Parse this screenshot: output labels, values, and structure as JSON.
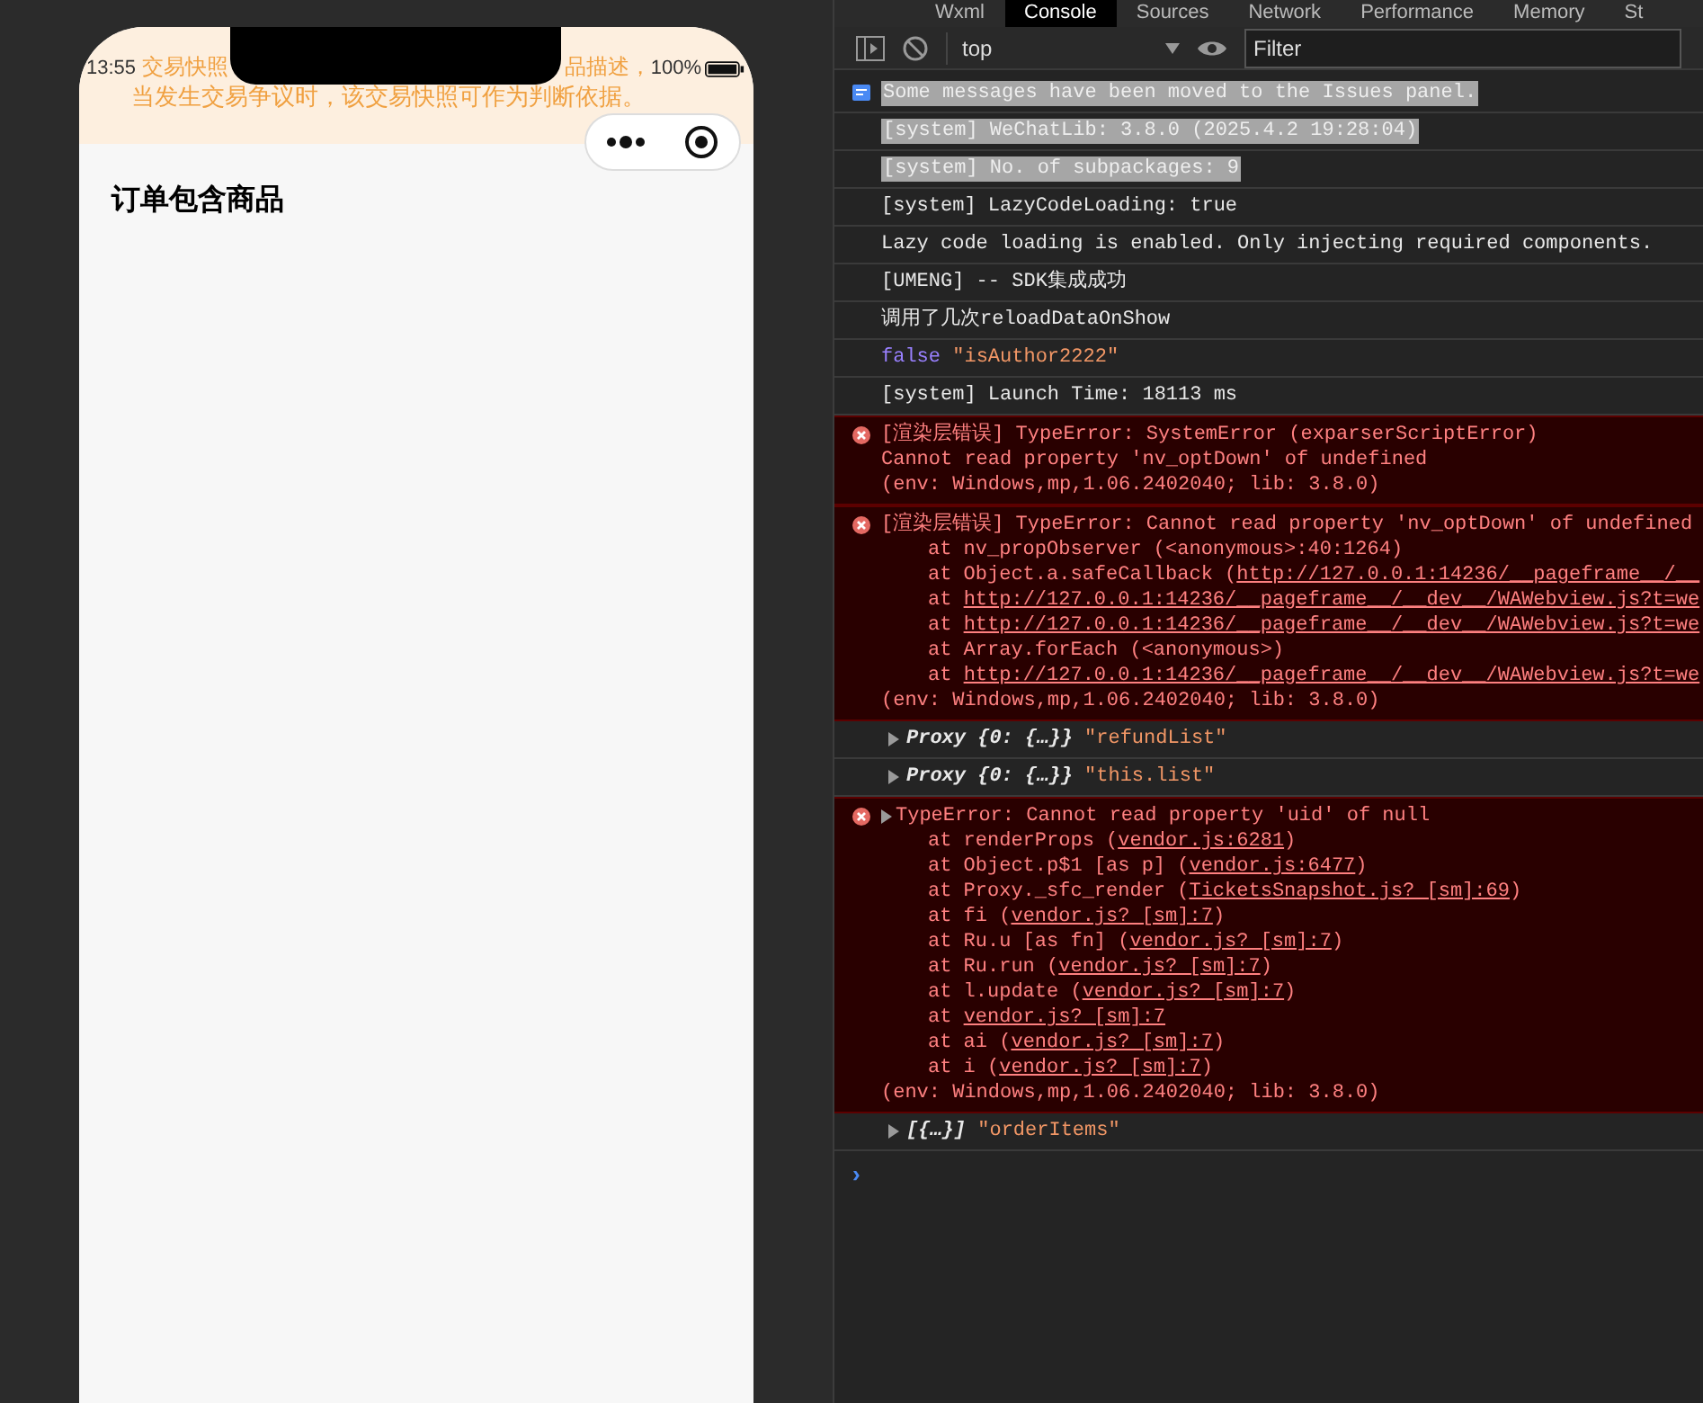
{
  "phone": {
    "status_bar": {
      "time": "13:55",
      "battery_text": "100%"
    },
    "banner": {
      "line1_left": "交易快照",
      "line1_right": "品描述，",
      "line2": "当发生交易争议时，该交易快照可作为判断依据。"
    },
    "title": "订单包含商品"
  },
  "devtools": {
    "tabs": [
      {
        "label": "Wxml",
        "selected": false
      },
      {
        "label": "Console",
        "selected": true
      },
      {
        "label": "Sources",
        "selected": false
      },
      {
        "label": "Network",
        "selected": false
      },
      {
        "label": "Performance",
        "selected": false
      },
      {
        "label": "Memory",
        "selected": false
      },
      {
        "label": "St",
        "selected": false
      }
    ],
    "context": "top",
    "filter": {
      "placeholder": "Filter"
    },
    "messages": [
      {
        "kind": "info",
        "text": "Some messages have been moved to the Issues panel.",
        "highlighted": true
      },
      {
        "kind": "log",
        "text": "[system] WeChatLib: 3.8.0 (2025.4.2 19:28:04)",
        "highlighted": true
      },
      {
        "kind": "log",
        "text": "[system] No. of subpackages: 9",
        "highlighted": true
      },
      {
        "kind": "log",
        "text": "[system] LazyCodeLoading: true",
        "highlighted": false
      },
      {
        "kind": "log",
        "text": "Lazy code loading is enabled. Only injecting required components.",
        "highlighted": false
      },
      {
        "kind": "log",
        "text": "[UMENG] -- SDK集成成功",
        "highlighted": false
      },
      {
        "kind": "log",
        "text": "调用了几次reloadDataOnShow",
        "highlighted": false
      },
      {
        "kind": "value",
        "value": "false",
        "string": "\"isAuthor2222\""
      },
      {
        "kind": "log",
        "text": "[system] Launch Time: 18113 ms",
        "highlighted": false
      },
      {
        "kind": "error",
        "expandable": false,
        "title": "[渲染层错误] TypeError: SystemError (exparserScriptError)",
        "detail": "Cannot read property 'nv_optDown' of undefined",
        "env": "(env: Windows,mp,1.06.2402040; lib: 3.8.0)"
      },
      {
        "kind": "error",
        "expandable": false,
        "title": "[渲染层错误] TypeError: Cannot read property 'nv_optDown' of undefined",
        "stack": [
          {
            "text": "at nv_propObserver (<anonymous>:40:1264)"
          },
          {
            "text": "at Object.a.safeCallback (",
            "link": "http://127.0.0.1:14236/__pageframe__/__"
          },
          {
            "text": "at ",
            "link": "http://127.0.0.1:14236/__pageframe__/__dev__/WAWebview.js?t=we"
          },
          {
            "text": "at ",
            "link": "http://127.0.0.1:14236/__pageframe__/__dev__/WAWebview.js?t=we"
          },
          {
            "text": "at Array.forEach (<anonymous>)"
          },
          {
            "text": "at ",
            "link": "http://127.0.0.1:14236/__pageframe__/__dev__/WAWebview.js?t=we"
          }
        ],
        "env": "(env: Windows,mp,1.06.2402040; lib: 3.8.0)"
      },
      {
        "kind": "object",
        "label": "Proxy {0: {…}}",
        "string": "\"refundList\"",
        "expanded": false
      },
      {
        "kind": "object",
        "label": "Proxy {0: {…}}",
        "string": "\"this.list\"",
        "expanded": false
      },
      {
        "kind": "error",
        "expandable": true,
        "title": "TypeError: Cannot read property 'uid' of null",
        "stack": [
          {
            "text": "at renderProps (",
            "link": "vendor.js:6281",
            "after": ")"
          },
          {
            "text": "at Object.p$1 [as p] (",
            "link": "vendor.js:6477",
            "after": ")"
          },
          {
            "text": "at Proxy._sfc_render (",
            "link": "TicketsSnapshot.js? [sm]:69",
            "after": ")"
          },
          {
            "text": "at fi (",
            "link": "vendor.js? [sm]:7",
            "after": ")"
          },
          {
            "text": "at Ru.u [as fn] (",
            "link": "vendor.js? [sm]:7",
            "after": ")"
          },
          {
            "text": "at Ru.run (",
            "link": "vendor.js? [sm]:7",
            "after": ")"
          },
          {
            "text": "at l.update (",
            "link": "vendor.js? [sm]:7",
            "after": ")"
          },
          {
            "text": "at ",
            "link": "vendor.js? [sm]:7"
          },
          {
            "text": "at ai (",
            "link": "vendor.js? [sm]:7",
            "after": ")"
          },
          {
            "text": "at i (",
            "link": "vendor.js? [sm]:7",
            "after": ")"
          }
        ],
        "env": "(env: Windows,mp,1.06.2402040; lib: 3.8.0)"
      },
      {
        "kind": "object",
        "label": "[{…}]",
        "string": "\"orderItems\"",
        "expanded": false
      }
    ],
    "prompt": "›"
  }
}
